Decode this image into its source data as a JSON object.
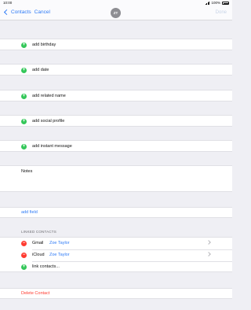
{
  "status_bar": {
    "time": "10:00",
    "battery": "100%"
  },
  "nav": {
    "back_label": "Contacts",
    "cancel_label": "Cancel",
    "avatar_initials": "ZT",
    "done_label": "Done"
  },
  "add_rows": [
    {
      "label": "add birthday"
    },
    {
      "label": "add date"
    },
    {
      "label": "add related name"
    },
    {
      "label": "add social profile"
    },
    {
      "label": "add instant message"
    }
  ],
  "notes": {
    "label": "Notes"
  },
  "add_field": {
    "label": "add field"
  },
  "linked": {
    "header": "LINKED CONTACTS",
    "items": [
      {
        "source": "Gmail",
        "name": "Zoe Taylor"
      },
      {
        "source": "iCloud",
        "name": "Zoe Taylor"
      }
    ],
    "link_label": "link contacts..."
  },
  "delete": {
    "label": "Delete Contact"
  },
  "colors": {
    "accent": "#2f7bf6",
    "add": "#34c759",
    "remove": "#ff3b30",
    "background": "#efeff4"
  }
}
